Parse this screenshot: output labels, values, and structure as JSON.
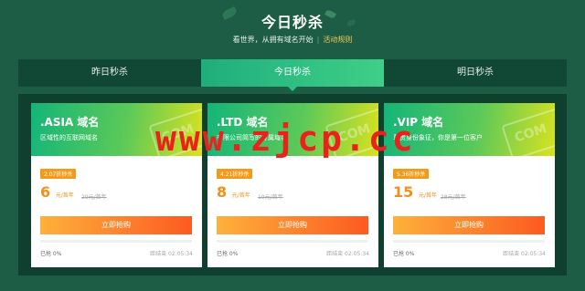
{
  "header": {
    "title": "今日秒杀",
    "subtitle": "看世界，从拥有域名开始",
    "rules_link": "活动规则"
  },
  "tabs": [
    {
      "label": "昨日秒杀",
      "active": false
    },
    {
      "label": "今日秒杀",
      "active": true
    },
    {
      "label": "明日秒杀",
      "active": false
    }
  ],
  "cards": [
    {
      "name": ".ASIA 域名",
      "desc": "区域性的互联网域名",
      "badge": "2.07折秒杀",
      "price": "6",
      "unit": "元/首年",
      "orig": "29元/首年",
      "button": "立即抢购",
      "sold": "已抢 0%",
      "end": "距结束 02:05:34",
      "progress": 0
    },
    {
      "name": ".LTD 域名",
      "desc": "有限公司简写的专属域名",
      "badge": "4.21折秒杀",
      "price": "8",
      "unit": "元/首年",
      "orig": "19元/首年",
      "button": "立即抢购",
      "sold": "已抢 0%",
      "end": "距结束 02:05:34",
      "progress": 0
    },
    {
      "name": ".VIP 域名",
      "desc": "尊贵身份象征，你是第一位客户",
      "badge": "5.36折秒杀",
      "price": "15",
      "unit": "元/首年",
      "orig": "28元/首年",
      "button": "立即抢购",
      "sold": "已抢 0%",
      "end": "距结束 02:05:34",
      "progress": 0
    }
  ],
  "deco_text": "COM",
  "watermark": "www.zjcp.cc",
  "colors": {
    "background": "#1d5c45",
    "accent": "#30c083",
    "price": "#f39019",
    "watermark": "#e8231c"
  }
}
